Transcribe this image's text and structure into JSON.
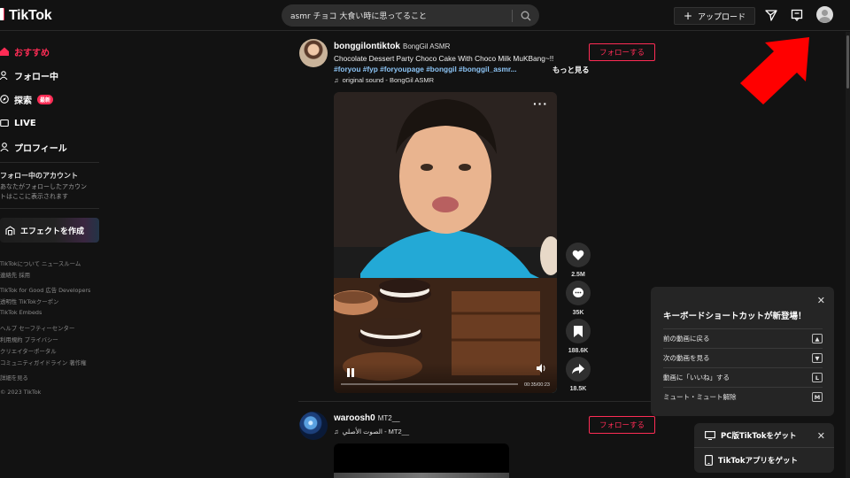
{
  "header": {
    "logo_text": "TikTok",
    "search_value": "asmr チョコ 大食い時に思ってること",
    "upload_label": "アップロード"
  },
  "sidebar": {
    "nav": [
      {
        "label": "おすすめ",
        "icon": "home-icon",
        "active": true
      },
      {
        "label": "フォロー中",
        "icon": "following-icon",
        "active": false
      },
      {
        "label": "探索",
        "icon": "compass-icon",
        "active": false,
        "badge": "最新"
      },
      {
        "label": "LIVE",
        "icon": "live-icon",
        "active": false
      },
      {
        "label": "プロフィール",
        "icon": "profile-icon",
        "active": false
      }
    ],
    "following_title": "フォロー中のアカウント",
    "following_note": [
      "あなたがフォローしたアカウン",
      "トはここに表示されます"
    ],
    "effect_label": "エフェクトを作成",
    "footer_lines": [
      "TikTokについて  ニュースルーム",
      "連絡先  採用",
      "TikTok for Good  広告  Developers",
      "透明性  TikTokクーポン",
      "TikTok Embeds",
      "ヘルプ  セーフティーセンター",
      "利用規約  プライバシー",
      "クリエイターポータル",
      "コミュニティガイドライン  著作権",
      "詳細を見る",
      "© 2023 TikTok"
    ]
  },
  "posts": [
    {
      "username": "bonggilontiktok",
      "nickname": "BongGil ASMR",
      "caption": "Chocolate Dessert Party Choco Cake With Choco Milk MuKBang~!!",
      "hashtags": "#foryou #fyp #foryoupage #bonggil #bonggil_asmr...",
      "more_label": "もっと見る",
      "sound": "original sound - BongGil ASMR",
      "follow_label": "フォローする",
      "time": "00:35/00:23",
      "actions": [
        {
          "icon": "heart-icon",
          "count": "2.5M"
        },
        {
          "icon": "comment-icon",
          "count": "35K"
        },
        {
          "icon": "bookmark-icon",
          "count": "188.6K"
        },
        {
          "icon": "share-icon",
          "count": "18.5K"
        }
      ]
    },
    {
      "username": "waroosh0",
      "nickname": "MT2__",
      "sound": "الصوت الأصلي - MT2__",
      "follow_label": "フォローする"
    }
  ],
  "shortcut_popup": {
    "title": "キーボードショートカットが新登場！",
    "rows": [
      {
        "label": "前の動画に戻る",
        "key": "▲"
      },
      {
        "label": "次の動画を見る",
        "key": "▼"
      },
      {
        "label": "動画に「いいね」する",
        "key": "L"
      },
      {
        "label": "ミュート・ミュート解除",
        "key": "M"
      }
    ]
  },
  "get_app": {
    "pc_label": "PC版TikTokをゲット",
    "app_label": "TikTokアプリをゲット"
  },
  "colors": {
    "accent": "#fe2c55",
    "hashtag": "#8cc4f5",
    "background": "#121212",
    "annotation_arrow": "#ff0000"
  }
}
